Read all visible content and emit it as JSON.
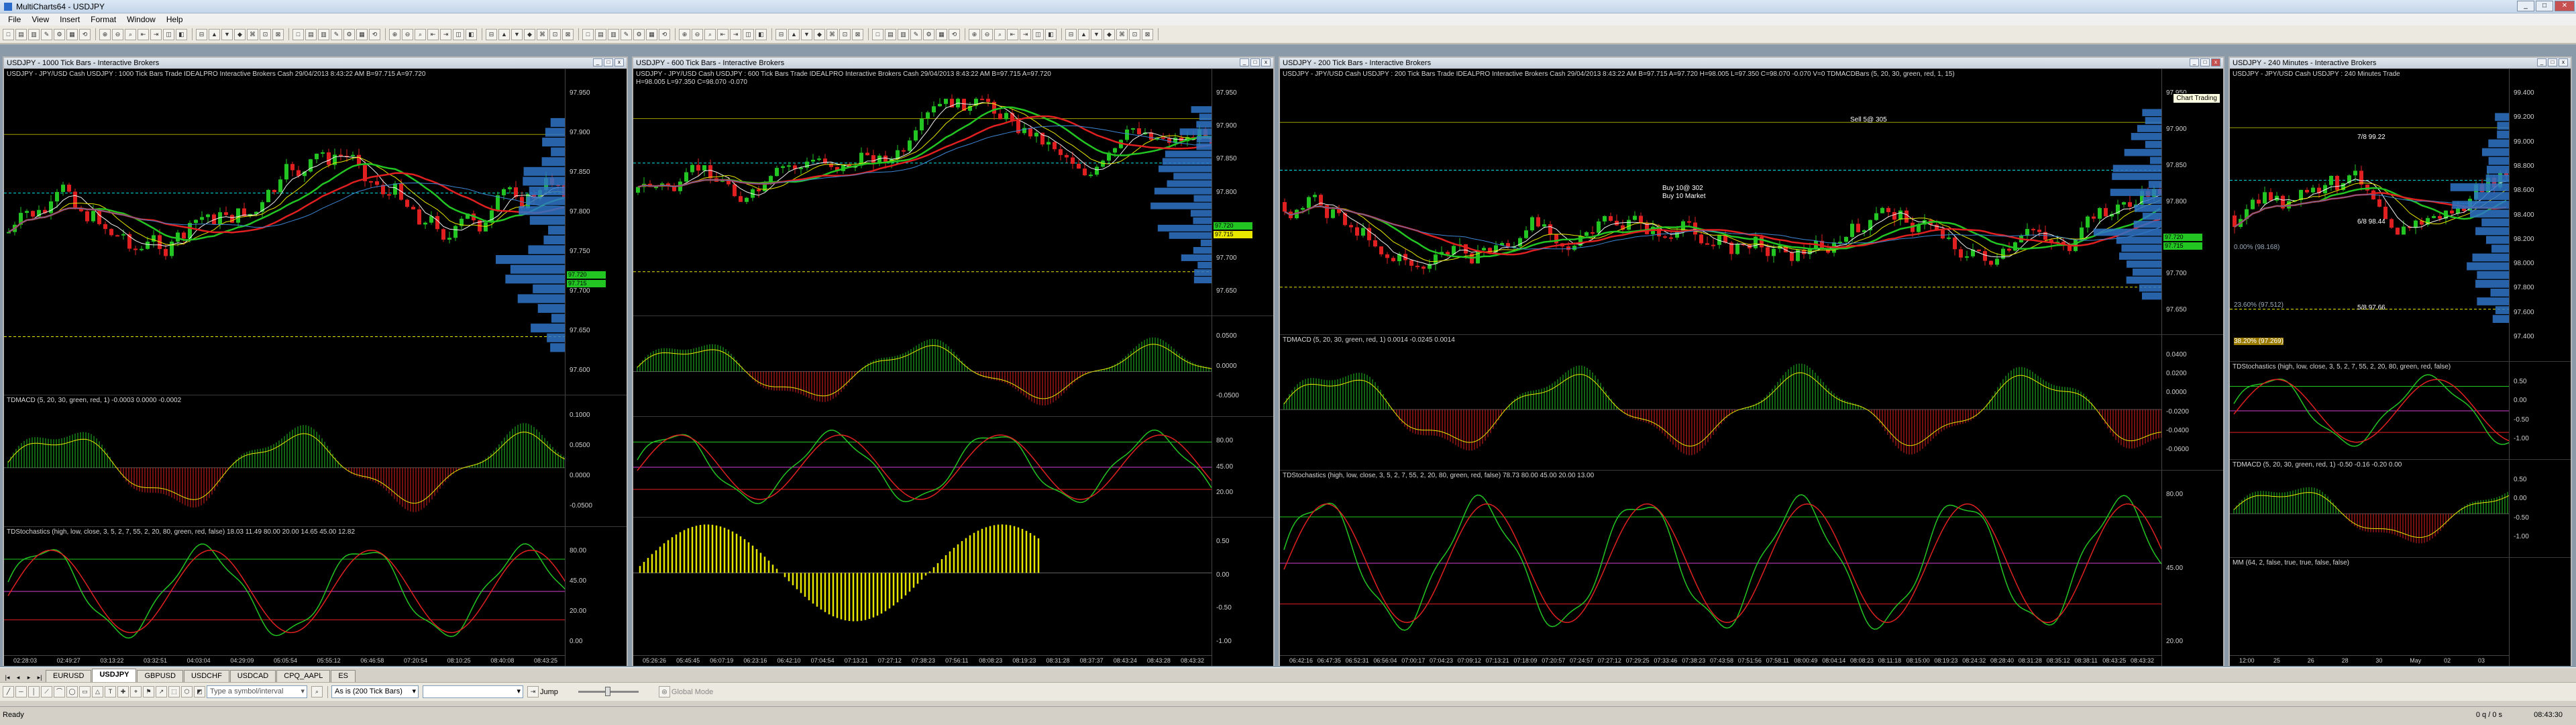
{
  "app": {
    "title": "MultiCharts64 - USDJPY",
    "buttons": [
      "_",
      "□",
      "✕"
    ]
  },
  "menu": [
    "File",
    "View",
    "Insert",
    "Format",
    "Window",
    "Help"
  ],
  "windows": [
    {
      "id": "w1",
      "title": "USDJPY - 1000 Tick Bars - Interactive Brokers",
      "price_label": "USDJPY - JPY/USD Cash USDJPY : 1000 Tick Bars    Trade IDEALPRO Interactive Brokers  Cash  29/04/2013  8:43:22 AM  B=97.715  A=97.720",
      "y_ticks": [
        "97.950",
        "97.900",
        "97.850",
        "97.800",
        "97.750",
        "97.700",
        "97.650",
        "97.600"
      ],
      "price_tags": [
        {
          "text": "97.720",
          "color": "#22c522"
        },
        {
          "text": "97.715",
          "color": "#22c522"
        }
      ],
      "macd_label": "TDMACD (5, 20, 30, green, red, 1)  -0.0003  0.0000  -0.0002",
      "macd_ticks": [
        "0.1000",
        "0.0500",
        "0.0000",
        "-0.0500"
      ],
      "stoch_label": "TDStochastics (high, low, close, 3, 5, 2, 7, 55, 2, 20, 80, green, red, false)  18.03  11.49  80.00  20.00  14.65  45.00  12.82",
      "stoch_ticks": [
        "80.00",
        "45.00",
        "20.00",
        "0.00"
      ],
      "x_ticks": [
        "02:28:03",
        "02:49:27",
        "03:13:22",
        "03:32:51",
        "04:03:04",
        "04:29:09",
        "05:05:54",
        "05:55:12",
        "06:46:58",
        "07:20:54",
        "08:10:25",
        "08:40:08",
        "08:43:25"
      ]
    },
    {
      "id": "w2",
      "title": "USDJPY - 600 Tick Bars - Interactive Brokers",
      "price_label": "USDJPY - JPY/USD Cash USDJPY : 600 Tick Bars    Trade IDEALPRO Interactive Brokers  Cash  29/04/2013  8:43:22 AM  B=97.715  A=97.720",
      "price_label2": "H=98.005  L=97.350  C=98.070  -0.070",
      "y_ticks": [
        "97.950",
        "97.900",
        "97.850",
        "97.800",
        "97.750",
        "97.700",
        "97.650"
      ],
      "price_tags": [
        {
          "text": "97.720",
          "color": "#22c522"
        },
        {
          "text": "97.715",
          "color": "#e8e800"
        }
      ],
      "macd_ticks": [
        "0.0500",
        "0.0000",
        "-0.0500"
      ],
      "stoch_ticks": [
        "80.00",
        "45.00",
        "20.00"
      ],
      "osc_ticks": [
        "0.50",
        "0.00",
        "-0.50",
        "-1.00"
      ],
      "x_ticks": [
        "05:26:26",
        "05:45:45",
        "06:07:19",
        "06:23:16",
        "06:42:10",
        "07:04:54",
        "07:13:21",
        "07:27:12",
        "07:38:23",
        "07:56:11",
        "08:08:23",
        "08:19:23",
        "08:31:28",
        "08:37:37",
        "08:43:24",
        "08:43:28",
        "08:43:32"
      ]
    },
    {
      "id": "w3",
      "title": "USDJPY - 200 Tick Bars - Interactive Brokers",
      "price_label": "USDJPY - JPY/USD Cash USDJPY : 200 Tick Bars    Trade IDEALPRO Interactive Brokers  Cash  29/04/2013  8:43:22 AM  B=97.715  A=97.720  H=98.005  L=97.350  C=98.070  -0.070  V=0    TDMACDBars (5, 20, 30, green, red, 1, 15)",
      "tooltip": "Chart Trading",
      "y_ticks": [
        "97.950",
        "97.900",
        "97.850",
        "97.800",
        "97.750",
        "97.700",
        "97.650"
      ],
      "price_tags": [
        {
          "text": "97.720",
          "color": "#22c522"
        },
        {
          "text": "97.715",
          "color": "#22c522"
        }
      ],
      "annotations": [
        "Sell 5@ 305",
        "Buy 10@ 302",
        "Buy 10 Market"
      ],
      "macd_label": "TDMACD (5, 20, 30, green, red, 1)  0.0014  -0.0245  0.0014",
      "macd_ticks": [
        "0.0400",
        "0.0200",
        "0.0000",
        "-0.0200",
        "-0.0400",
        "-0.0600"
      ],
      "stoch_label": "TDStochastics (high, low, close, 3, 5, 2, 7, 55, 2, 20, 80, green, red, false)  78.73  80.00  45.00  20.00  13.00",
      "stoch_ticks": [
        "80.00",
        "45.00",
        "20.00"
      ],
      "x_ticks": [
        "06:42:16",
        "06:47:35",
        "06:52:31",
        "06:56:04",
        "07:00:17",
        "07:04:23",
        "07:09:12",
        "07:13:21",
        "07:18:09",
        "07:20:57",
        "07:24:57",
        "07:27:12",
        "07:29:25",
        "07:33:46",
        "07:38:23",
        "07:43:58",
        "07:51:56",
        "07:58:11",
        "08:00:49",
        "08:04:14",
        "08:08:23",
        "08:11:18",
        "08:15:00",
        "08:19:23",
        "08:24:32",
        "08:28:40",
        "08:31:28",
        "08:35:12",
        "08:38:11",
        "08:43:25",
        "08:43:32"
      ]
    },
    {
      "id": "w4",
      "title": "USDJPY - 240 Minutes - Interactive Brokers",
      "price_label": "USDJPY - JPY/USD Cash USDJPY : 240 Minutes  Trade",
      "y_ticks": [
        "99.400",
        "99.200",
        "99.000",
        "98.800",
        "98.600",
        "98.400",
        "98.200",
        "98.000",
        "97.800",
        "97.600",
        "97.400"
      ],
      "levels": [
        "7/8  99.22",
        "6/8  98.44",
        "5/8  97.66",
        "0.00% (98.168)",
        "23.60% (97.512)",
        "38.20% (97.269)"
      ],
      "stoch_label": "TDStochastics (high, low, close, 3, 5, 2, 7, 55, 2, 20, 80, green, red, false)",
      "macd_label": "TDMACD (5, 20, 30, green, red, 1)  -0.50  -0.16  -0.20  0.00",
      "mm_label": "MM (64, 2, false, true, true, false, false)",
      "macd_ticks": [
        "0.50",
        "0.00",
        "-0.50",
        "-1.00"
      ],
      "x_ticks": [
        "12:00",
        "25",
        "26",
        "28",
        "30",
        "May",
        "02",
        "03"
      ]
    }
  ],
  "symbol_tabs": [
    "EURUSD",
    "USDJPY",
    "GBPUSD",
    "USDCHF",
    "USDCAD",
    "CPQ_AAPL",
    "ES"
  ],
  "active_tab": "USDJPY",
  "draw_toolbar": {
    "symbol_placeholder": "Type a symbol/interval",
    "interval": "As is (200 Tick Bars)",
    "jump": "Jump",
    "global_mode": "Global Mode"
  },
  "status": {
    "left": "Ready",
    "right_info": "0 q / 0 s",
    "time": "08:43:30"
  }
}
